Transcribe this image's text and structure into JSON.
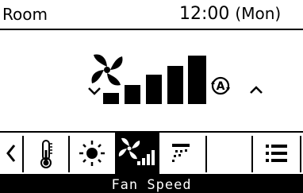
{
  "header": {
    "location": "Room",
    "time": "12:00",
    "day": "(Mon)"
  },
  "fan": {
    "icon": "fan-icon",
    "speed_level": 5,
    "speed_max": 5,
    "auto_icon": "auto-a-icon"
  },
  "toolbar": {
    "items": [
      {
        "name": "scroll-left",
        "icon": "chevron-left-icon"
      },
      {
        "name": "temperature",
        "icon": "thermometer-icon"
      },
      {
        "name": "mode",
        "icon": "sun-icon"
      },
      {
        "name": "fan-speed",
        "icon": "fan-speed-icon",
        "selected": true
      },
      {
        "name": "air-direction",
        "icon": "louver-icon"
      },
      {
        "name": "blank",
        "icon": ""
      },
      {
        "name": "menu",
        "icon": "menu-icon"
      }
    ]
  },
  "footer": {
    "label": "Fan Speed"
  }
}
